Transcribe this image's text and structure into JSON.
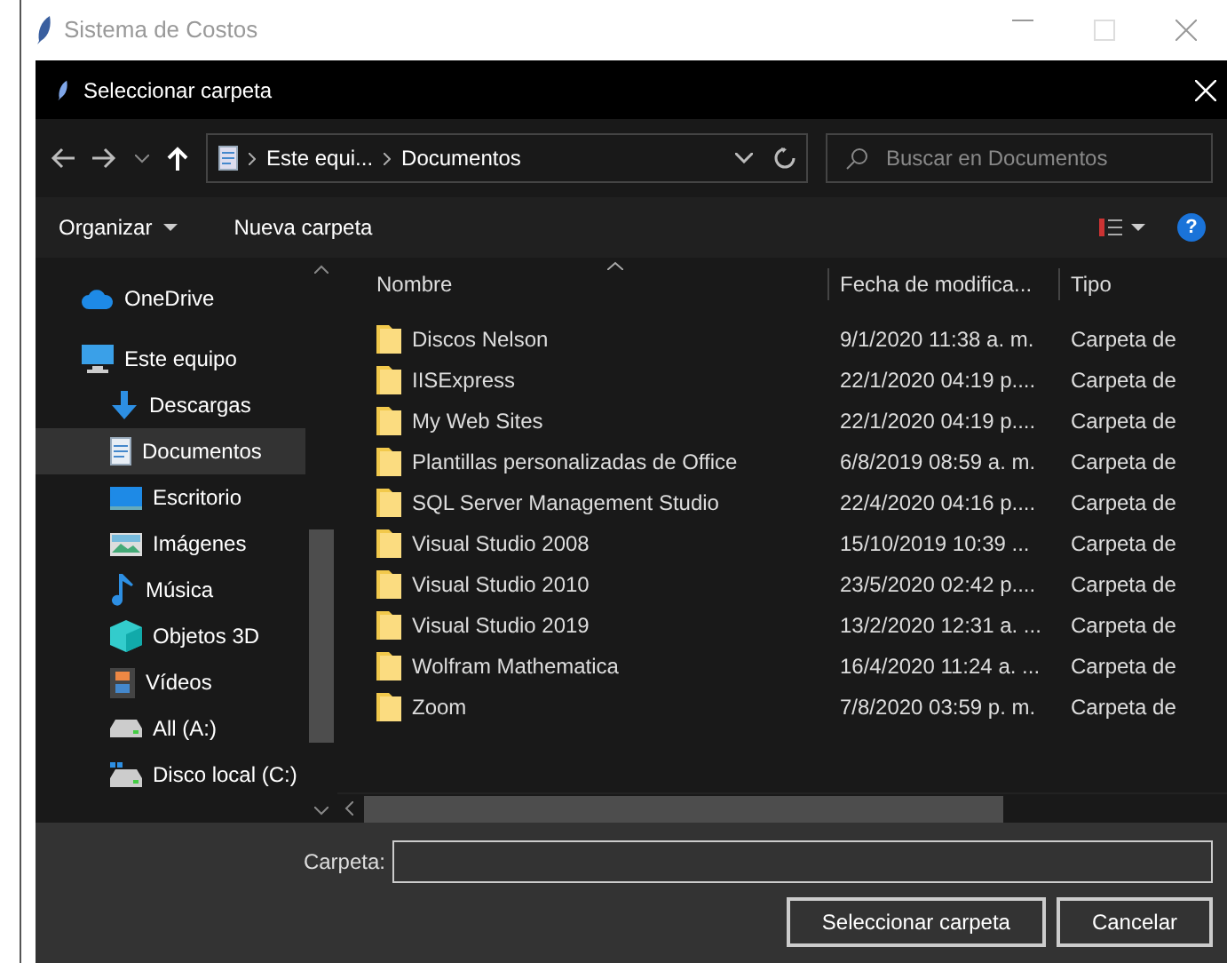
{
  "window": {
    "title": "Sistema de Costos"
  },
  "dialog": {
    "title": "Seleccionar carpeta"
  },
  "address": {
    "crumbs": [
      "Este equi...",
      "Documentos"
    ],
    "search_placeholder": "Buscar en Documentos"
  },
  "toolbar": {
    "organize": "Organizar",
    "new_folder": "Nueva carpeta",
    "help": "?"
  },
  "sidebar": {
    "items": [
      {
        "label": "OneDrive",
        "kind": "cloud",
        "selected": false
      },
      {
        "label": "Este equipo",
        "kind": "pc",
        "selected": false,
        "children": [
          {
            "label": "Descargas",
            "kind": "download",
            "selected": false
          },
          {
            "label": "Documentos",
            "kind": "document",
            "selected": true
          },
          {
            "label": "Escritorio",
            "kind": "desktop",
            "selected": false
          },
          {
            "label": "Imágenes",
            "kind": "image",
            "selected": false
          },
          {
            "label": "Música",
            "kind": "music",
            "selected": false
          },
          {
            "label": "Objetos 3D",
            "kind": "cube",
            "selected": false
          },
          {
            "label": "Vídeos",
            "kind": "video",
            "selected": false
          },
          {
            "label": "All (A:)",
            "kind": "drive",
            "selected": false
          },
          {
            "label": "Disco local (C:)",
            "kind": "system-drive",
            "selected": false
          }
        ]
      }
    ]
  },
  "table": {
    "columns": [
      "Nombre",
      "Fecha de modifica...",
      "Tipo"
    ],
    "rows": [
      [
        "Discos Nelson",
        "9/1/2020 11:38 a. m.",
        "Carpeta de"
      ],
      [
        "IISExpress",
        "22/1/2020 04:19 p....",
        "Carpeta de"
      ],
      [
        "My Web Sites",
        "22/1/2020 04:19 p....",
        "Carpeta de"
      ],
      [
        "Plantillas personalizadas de Office",
        "6/8/2019 08:59 a. m.",
        "Carpeta de"
      ],
      [
        "SQL Server Management Studio",
        "22/4/2020 04:16 p....",
        "Carpeta de"
      ],
      [
        "Visual Studio 2008",
        "15/10/2019 10:39 ...",
        "Carpeta de"
      ],
      [
        "Visual Studio 2010",
        "23/5/2020 02:42 p....",
        "Carpeta de"
      ],
      [
        "Visual Studio 2019",
        "13/2/2020 12:31 a. ...",
        "Carpeta de"
      ],
      [
        "Wolfram Mathematica",
        "16/4/2020 11:24 a. ...",
        "Carpeta de"
      ],
      [
        "Zoom",
        "7/8/2020 03:59 p. m.",
        "Carpeta de"
      ]
    ]
  },
  "footer": {
    "folder_label": "Carpeta:",
    "buttons": [
      "Seleccionar carpeta",
      "Cancelar"
    ]
  }
}
